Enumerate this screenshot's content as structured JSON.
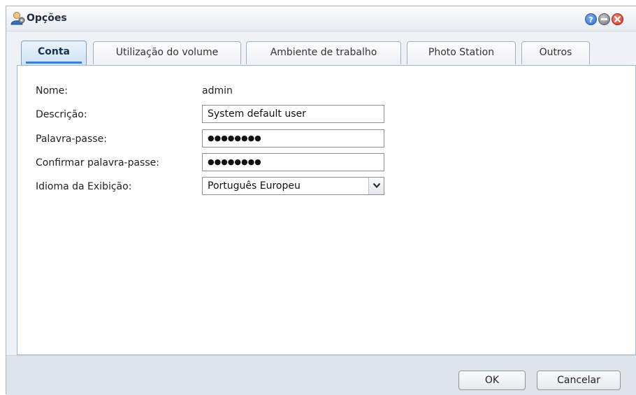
{
  "window": {
    "title": "Opções"
  },
  "tabs": [
    {
      "label": "Conta",
      "active": true
    },
    {
      "label": "Utilização do volume",
      "active": false
    },
    {
      "label": "Ambiente de trabalho",
      "active": false
    },
    {
      "label": "Photo Station",
      "active": false
    },
    {
      "label": "Outros",
      "active": false
    }
  ],
  "form": {
    "name_label": "Nome:",
    "name_value": "admin",
    "description_label": "Descrição:",
    "description_value": "System default user",
    "password_label": "Palavra-passe:",
    "password_value": "●●●●●●●●",
    "confirm_label": "Confirmar palavra-passe:",
    "confirm_value": "●●●●●●●●",
    "language_label": "Idioma da Exibição:",
    "language_value": "Português Europeu"
  },
  "buttons": {
    "ok": "OK",
    "cancel": "Cancelar"
  },
  "icons": {
    "title": "user-settings-icon",
    "help": "help-icon",
    "minimize": "minimize-icon",
    "close": "close-icon",
    "dropdown": "chevron-down-icon"
  },
  "colors": {
    "accent": "#3b7fd0",
    "close": "#d2321e",
    "help": "#2d6dcf"
  }
}
